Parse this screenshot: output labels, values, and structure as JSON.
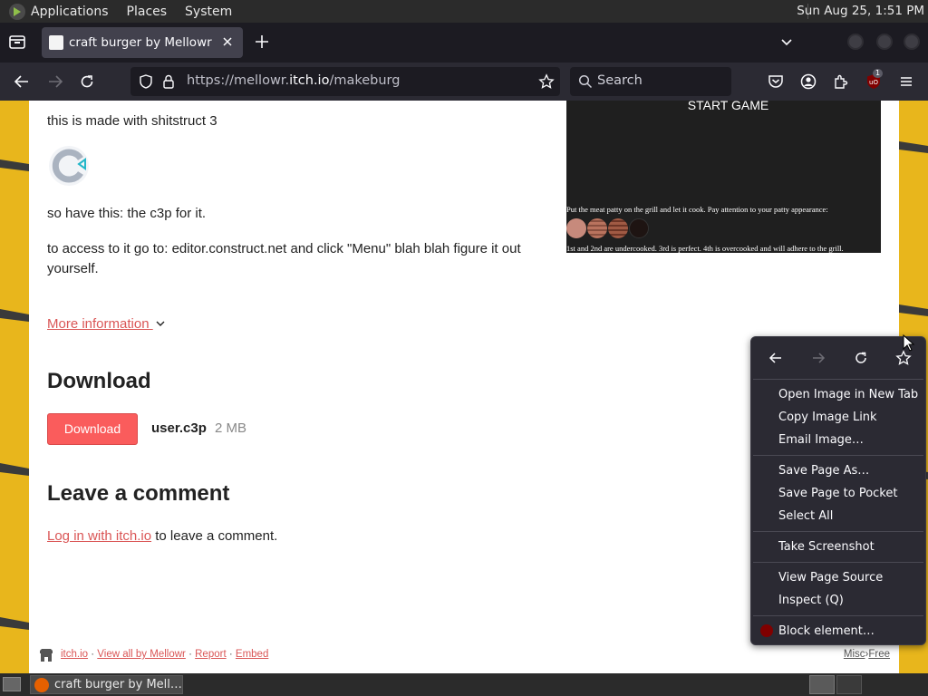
{
  "gnome_panel": {
    "menus": [
      "Applications",
      "Places",
      "System"
    ],
    "clock": "Sun Aug 25,  1:51 PM"
  },
  "browser": {
    "tab_title": "craft burger by Mellowr",
    "url_prefix": "https://mellowr.",
    "url_domain": "itch.io",
    "url_path": "/makeburg",
    "search_placeholder": "Search",
    "ublock_badge": "1"
  },
  "page": {
    "intro_text": "this is made with shitstruct 3",
    "c3p_text": "so have this: the c3p for it.",
    "access_text": "to access to it go to: editor.construct.net and click \"Menu\" blah blah figure it out yourself.",
    "more_info": "More information",
    "download_heading": "Download",
    "download_button": "Download",
    "file_name": "user.c3p",
    "file_size": "2 MB",
    "comment_heading": "Leave a comment",
    "login_link": "Log in with itch.io",
    "login_suffix": " to leave a comment.",
    "game": {
      "start_label": "START GAME",
      "instruction": "Put the meat patty on the grill and let it cook. Pay attention to your patty appearance:",
      "note": "1st and 2nd are undercooked. 3rd is perfect. 4th is overcooked and will adhere to the grill.",
      "patty_colors": [
        "#c78a7c",
        "#b9735e",
        "#a05a44",
        "#1e1412"
      ]
    },
    "footer": {
      "links": [
        "itch.io",
        "View all by Mellowr",
        "Report",
        "Embed"
      ],
      "separator": "·",
      "right_misc": "Misc",
      "right_arrow": "›",
      "right_free": "Free"
    }
  },
  "context_menu": {
    "items": [
      "Open Image in New Tab",
      "Copy Image Link",
      "Email Image…",
      "Save Page As…",
      "Save Page to Pocket",
      "Select All",
      "Take Screenshot",
      "View Page Source",
      "Inspect (Q)",
      "Block element…"
    ]
  },
  "taskbar": {
    "window_title": "craft burger by Mell…"
  },
  "colors": {
    "accent": "#fa5c5c",
    "link": "#da5656",
    "page_bg": "#e8b61c"
  }
}
